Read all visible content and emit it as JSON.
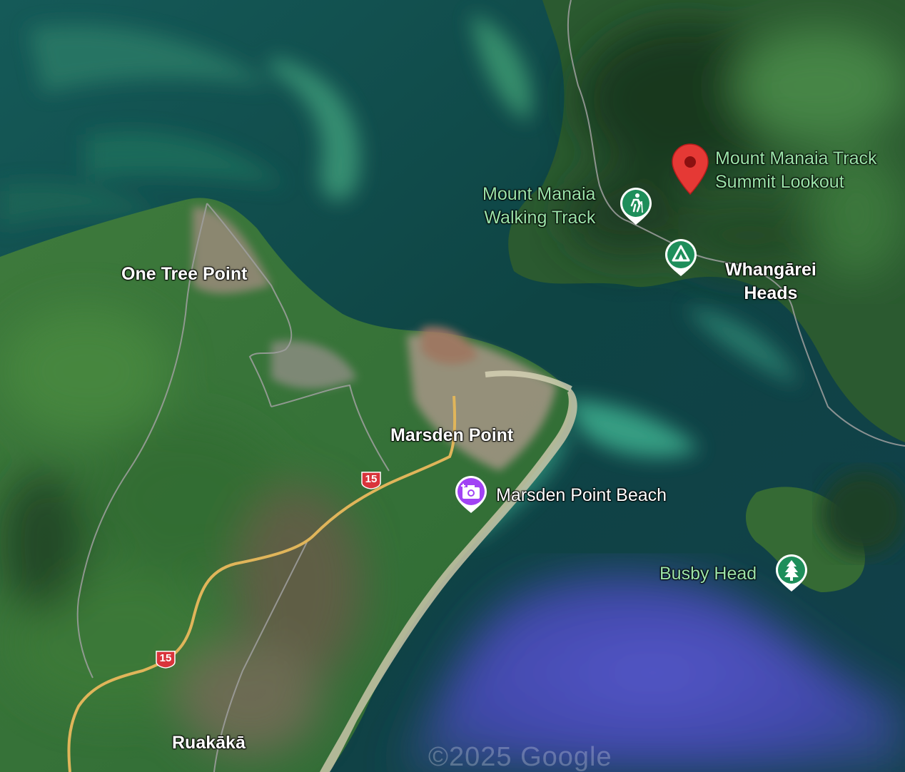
{
  "map": {
    "type": "satellite",
    "region": "Whangarei Harbour entrance",
    "colors": {
      "deep_water": "#0f4545",
      "shallow_water": "#2f8a70",
      "ocean_blue": "#4a4bb8",
      "land_green": "#3d7a3a",
      "forest_dark": "#1a3d22",
      "beach_sand": "#c9c5a8",
      "road_major": "#e0b55a",
      "road_minor": "#9a9a9a",
      "pin_red": "#e53935",
      "pin_green": "#1e8e5a",
      "pin_purple": "#a142f4"
    }
  },
  "places": {
    "one_tree_point": "One Tree Point",
    "marsden_point": "Marsden Point",
    "ruakaka": "Ruakākā",
    "whangarei_heads_line1": "Whangārei",
    "whangarei_heads_line2": "Heads"
  },
  "pois": {
    "summit_line1": "Mount Manaia Track",
    "summit_line2": "Summit Lookout",
    "summit_icon": "red-map-pin-icon",
    "walking_line1": "Mount Manaia",
    "walking_line2": "Walking Track",
    "walking_icon": "hiking-icon",
    "camp_icon": "campground-icon",
    "beach_label": "Marsden Point Beach",
    "beach_icon": "camera-icon",
    "busby_label": "Busby Head",
    "busby_icon": "tree-icon"
  },
  "roads": {
    "shield_upper": "15",
    "shield_lower": "15"
  },
  "attribution": "©2025 Google"
}
